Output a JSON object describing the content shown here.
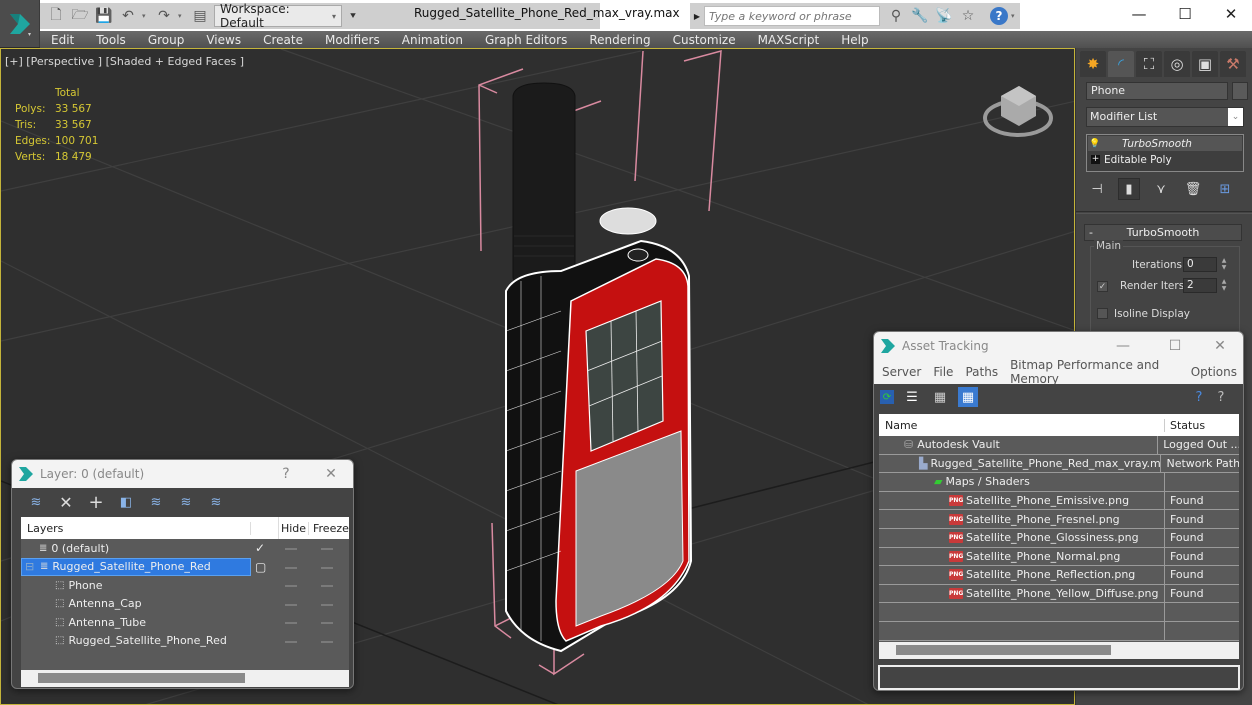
{
  "titlebar": {
    "title": "Rugged_Satellite_Phone_Red_max_vray.max",
    "workspace": "Workspace: Default",
    "search_placeholder": "Type a keyword or phrase",
    "minimize": "—",
    "maximize": "☐",
    "close": "✕",
    "icons": [
      "new-file-icon",
      "open-folder-icon",
      "save-icon",
      "undo-icon",
      "redo-icon",
      "project-icon",
      "binoculars-icon",
      "key-icon",
      "satellite-icon",
      "star-icon",
      "help-icon"
    ]
  },
  "menu": [
    "Edit",
    "Tools",
    "Group",
    "Views",
    "Create",
    "Modifiers",
    "Animation",
    "Graph Editors",
    "Rendering",
    "Customize",
    "MAXScript",
    "Help"
  ],
  "viewport": {
    "label": "[+] [Perspective ] [Shaded + Edged Faces ]",
    "stats": {
      "header": "Total",
      "rows": [
        {
          "k": "Polys:",
          "v": "33 567"
        },
        {
          "k": "Tris:",
          "v": "33 567"
        },
        {
          "k": "Edges:",
          "v": "100 701"
        },
        {
          "k": "Verts:",
          "v": "18 479"
        }
      ]
    }
  },
  "command_panel": {
    "tabs": [
      "create-icon",
      "modify-icon",
      "hierarchy-icon",
      "motion-icon",
      "display-icon",
      "utilities-icon"
    ],
    "object_name": "Phone",
    "modifier_list": "Modifier List",
    "stack": [
      {
        "label": "TurboSmooth",
        "icon": "bulb-icon"
      },
      {
        "label": "Editable Poly",
        "icon": "plus-icon"
      }
    ],
    "rollout": {
      "title": "TurboSmooth",
      "group": "Main",
      "iterations_label": "Iterations:",
      "iterations": "0",
      "render_iters_label": "Render Iters:",
      "render_iters": "2",
      "render_iters_checked": true,
      "isoline_label": "Isoline Display",
      "isoline_checked": false
    }
  },
  "asset_tracking": {
    "title": "Asset Tracking",
    "menu": [
      "Server",
      "File",
      "Paths",
      "Bitmap Performance and Memory",
      "Options"
    ],
    "columns": [
      "Name",
      "Status"
    ],
    "rows": [
      {
        "name": "Autodesk Vault",
        "status": "Logged Out ...",
        "indent": 1,
        "icon": "vault-icon"
      },
      {
        "name": "Rugged_Satellite_Phone_Red_max_vray.max",
        "status": "Network Path",
        "indent": 2,
        "icon": "max-file-icon"
      },
      {
        "name": "Maps / Shaders",
        "status": "",
        "indent": 3,
        "icon": "maps-icon"
      },
      {
        "name": "Satellite_Phone_Emissive.png",
        "status": "Found",
        "indent": 4,
        "icon": "png-icon"
      },
      {
        "name": "Satellite_Phone_Fresnel.png",
        "status": "Found",
        "indent": 4,
        "icon": "png-icon"
      },
      {
        "name": "Satellite_Phone_Glossiness.png",
        "status": "Found",
        "indent": 4,
        "icon": "png-icon"
      },
      {
        "name": "Satellite_Phone_Normal.png",
        "status": "Found",
        "indent": 4,
        "icon": "png-icon"
      },
      {
        "name": "Satellite_Phone_Reflection.png",
        "status": "Found",
        "indent": 4,
        "icon": "png-icon"
      },
      {
        "name": "Satellite_Phone_Yellow_Diffuse.png",
        "status": "Found",
        "indent": 4,
        "icon": "png-icon"
      }
    ]
  },
  "layer_dialog": {
    "title": "Layer: 0 (default)",
    "help": "?",
    "close": "✕",
    "columns": [
      "Layers",
      "Hide",
      "Freeze"
    ],
    "rows": [
      {
        "name": "0 (default)",
        "level": 0,
        "active": true,
        "selected": false
      },
      {
        "name": "Rugged_Satellite_Phone_Red",
        "level": 0,
        "active": false,
        "selected": true
      },
      {
        "name": "Phone",
        "level": 1
      },
      {
        "name": "Antenna_Cap",
        "level": 1
      },
      {
        "name": "Antenna_Tube",
        "level": 1
      },
      {
        "name": "Rugged_Satellite_Phone_Red",
        "level": 1
      }
    ]
  },
  "colors": {
    "accent": "#3a7ad0",
    "stats_yellow": "#d6c834",
    "selection_red": "#d01010",
    "bbox_pink": "#d98aa0"
  }
}
